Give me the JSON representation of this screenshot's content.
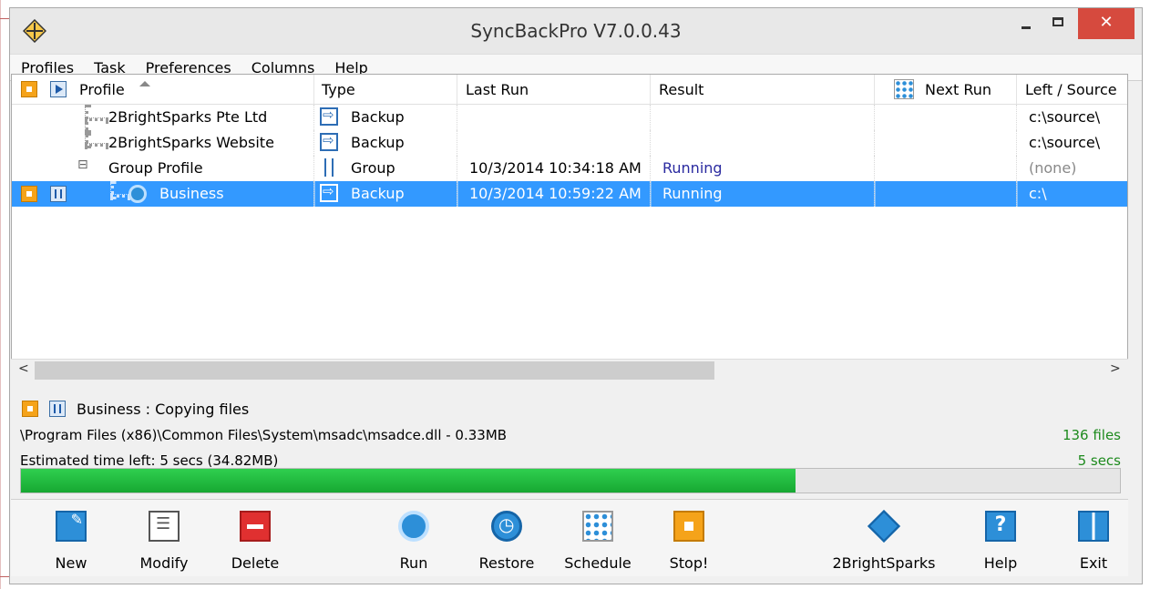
{
  "window": {
    "title": "SyncBackPro V7.0.0.43",
    "close_glyph": "✕"
  },
  "menu": [
    "Profiles",
    "Task",
    "Preferences",
    "Columns",
    "Help"
  ],
  "columns": {
    "profile": "Profile",
    "type": "Type",
    "last_run": "Last Run",
    "result": "Result",
    "next_run": "Next Run",
    "left_source": "Left / Source"
  },
  "rows": [
    {
      "profile": "2BrightSparks Pte Ltd",
      "type": "Backup",
      "last_run": "",
      "result": "",
      "next_run": "",
      "source": "c:\\source\\"
    },
    {
      "profile": "2BrightSparks Website",
      "type": "Backup",
      "last_run": "",
      "result": "",
      "next_run": "",
      "source": "c:\\source\\"
    },
    {
      "profile": "Group Profile",
      "type": "Group",
      "last_run": "10/3/2014 10:34:18 AM",
      "result": "Running",
      "next_run": "",
      "source": "(none)"
    },
    {
      "profile": "Business",
      "type": "Backup",
      "last_run": "10/3/2014 10:59:22 AM",
      "result": "Running",
      "next_run": "",
      "source": "c:\\"
    }
  ],
  "status": {
    "title": "Business : Copying files",
    "file": "\\Program Files (x86)\\Common Files\\System\\msadc\\msadce.dll - 0.33MB",
    "files_count": "136 files",
    "time_left": "Estimated time left: 5 secs (34.82MB)",
    "secs": "5 secs",
    "progress_fraction": 0.705
  },
  "toolbar": {
    "new": "New",
    "modify": "Modify",
    "delete": "Delete",
    "run": "Run",
    "restore": "Restore",
    "schedule": "Schedule",
    "stop": "Stop!",
    "brightsparks": "2BrightSparks",
    "help": "Help",
    "exit": "Exit"
  },
  "colors": {
    "selection": "#3399ff",
    "close_button": "#d64a3e",
    "progress": "#1fbf3f",
    "running_text": "#2a2aa0",
    "status_green": "#1d8a1d"
  }
}
